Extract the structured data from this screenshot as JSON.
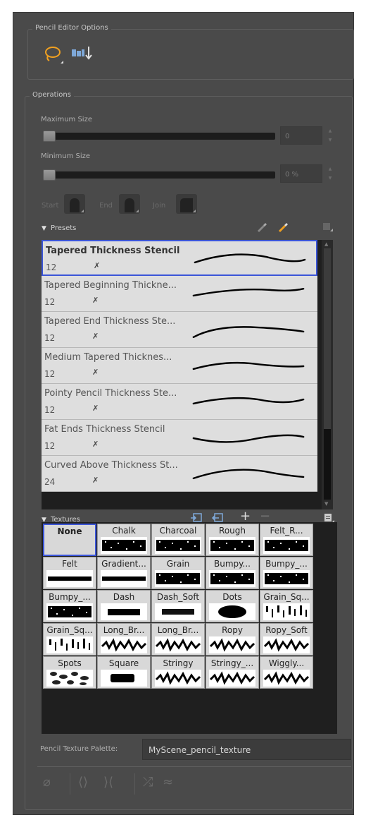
{
  "editor_options": {
    "title": "Pencil Editor Options",
    "lasso_icon": "lasso-icon",
    "perspective_icon": "contour-transform-icon"
  },
  "operations": {
    "title": "Operations",
    "max_size": {
      "label": "Maximum Size",
      "value": "0",
      "level": 0
    },
    "min_size": {
      "label": "Minimum Size",
      "value": "0 %",
      "level": 0
    },
    "caps": {
      "start_label": "Start",
      "end_label": "End",
      "join_label": "Join"
    }
  },
  "presets": {
    "header": "Presets",
    "items": [
      {
        "name": "Tapered Thickness Stencil",
        "size": "12",
        "selected": true
      },
      {
        "name": "Tapered Beginning Thickne...",
        "size": "12",
        "selected": false
      },
      {
        "name": "Tapered End Thickness Ste...",
        "size": "12",
        "selected": false
      },
      {
        "name": "Medium Tapered Thicknes...",
        "size": "12",
        "selected": false
      },
      {
        "name": "Pointy Pencil Thickness Ste...",
        "size": "12",
        "selected": false
      },
      {
        "name": "Fat Ends Thickness Stencil",
        "size": "12",
        "selected": false
      },
      {
        "name": "Curved Above Thickness St...",
        "size": "24",
        "selected": false
      }
    ]
  },
  "textures": {
    "header": "Textures",
    "items": [
      "None",
      "Chalk",
      "Charcoal",
      "Rough",
      "Felt_R...",
      "Felt",
      "Gradient...",
      "Grain",
      "Bumpy...",
      "Bumpy_...",
      "Bumpy_...",
      "Dash",
      "Dash_Soft",
      "Dots",
      "Grain_Sq...",
      "Grain_Sq...",
      "Long_Br...",
      "Long_Br...",
      "Ropy",
      "Ropy_Soft",
      "Spots",
      "Square",
      "Stringy",
      "Stringy_...",
      "Wiggly..."
    ],
    "selected": "None",
    "palette_label": "Pencil Texture Palette:",
    "palette_value": "MyScene_pencil_texture"
  },
  "colors": {
    "panel_bg": "#4a4a4a",
    "selection": "#3b55d8",
    "accent": "#f0a020"
  }
}
